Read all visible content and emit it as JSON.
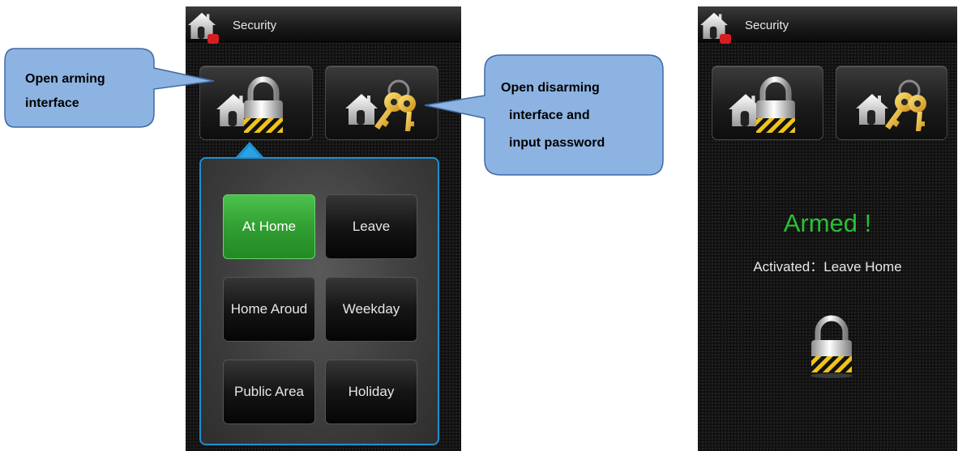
{
  "left_screen": {
    "title": "Security",
    "mode_options": [
      {
        "label": "At Home",
        "active": true
      },
      {
        "label": "Leave",
        "active": false
      },
      {
        "label": "Home Aroud",
        "active": false
      },
      {
        "label": "Weekday",
        "active": false
      },
      {
        "label": "Public Area",
        "active": false
      },
      {
        "label": "Holiday",
        "active": false
      }
    ]
  },
  "right_screen": {
    "title": "Security",
    "status": "Armed !",
    "activated": "Activated：Leave Home"
  },
  "callouts": {
    "arming": [
      "Open arming",
      "interface"
    ],
    "disarming": [
      "Open disarming",
      "interface and",
      "input password"
    ]
  },
  "icons": {
    "app": "home-security-icon",
    "arm": "home-lock-icon",
    "disarm": "home-keys-icon",
    "status": "padlock-icon"
  },
  "colors": {
    "accent_blue": "#1f8fd0",
    "active_green": "#2f9c30",
    "armed_green": "#2bbf36",
    "callout_fill": "#8db3e2"
  }
}
